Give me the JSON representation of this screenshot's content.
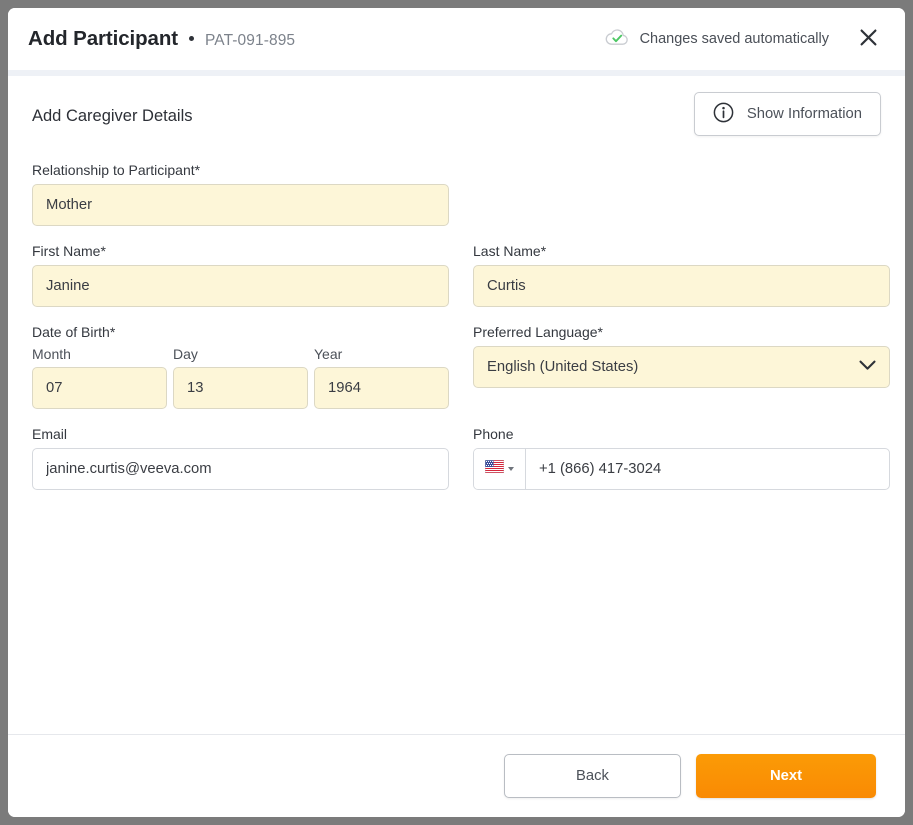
{
  "header": {
    "title": "Add Participant",
    "participant_id": "PAT-091-895",
    "save_status": "Changes saved automatically",
    "save_icon": "cloud-check-icon",
    "close_icon": "close-icon"
  },
  "body": {
    "section_title": "Add Caregiver Details",
    "info_button": {
      "label": "Show Information",
      "icon": "info-circle-icon"
    },
    "fields": {
      "relationship": {
        "label": "Relationship to Participant*",
        "value": "Mother"
      },
      "first_name": {
        "label": "First Name*",
        "value": "Janine"
      },
      "last_name": {
        "label": "Last Name*",
        "value": "Curtis"
      },
      "date_of_birth": {
        "label": "Date of Birth*",
        "month_label": "Month",
        "month_value": "07",
        "day_label": "Day",
        "day_value": "13",
        "year_label": "Year",
        "year_value": "1964"
      },
      "preferred_language": {
        "label": "Preferred Language*",
        "value": "English (United States)",
        "chevron_icon": "chevron-down-icon"
      },
      "email": {
        "label": "Email",
        "value": "janine.curtis@veeva.com"
      },
      "phone": {
        "label": "Phone",
        "country_flag": "us-flag-icon",
        "value": "+1 (866) 417-3024"
      }
    }
  },
  "footer": {
    "back_label": "Back",
    "next_label": "Next"
  },
  "colors": {
    "accent_orange": "#F98A04",
    "field_yellow": "#FDF6D8",
    "status_green": "#4CC764",
    "divider": "#EEF1F6"
  }
}
